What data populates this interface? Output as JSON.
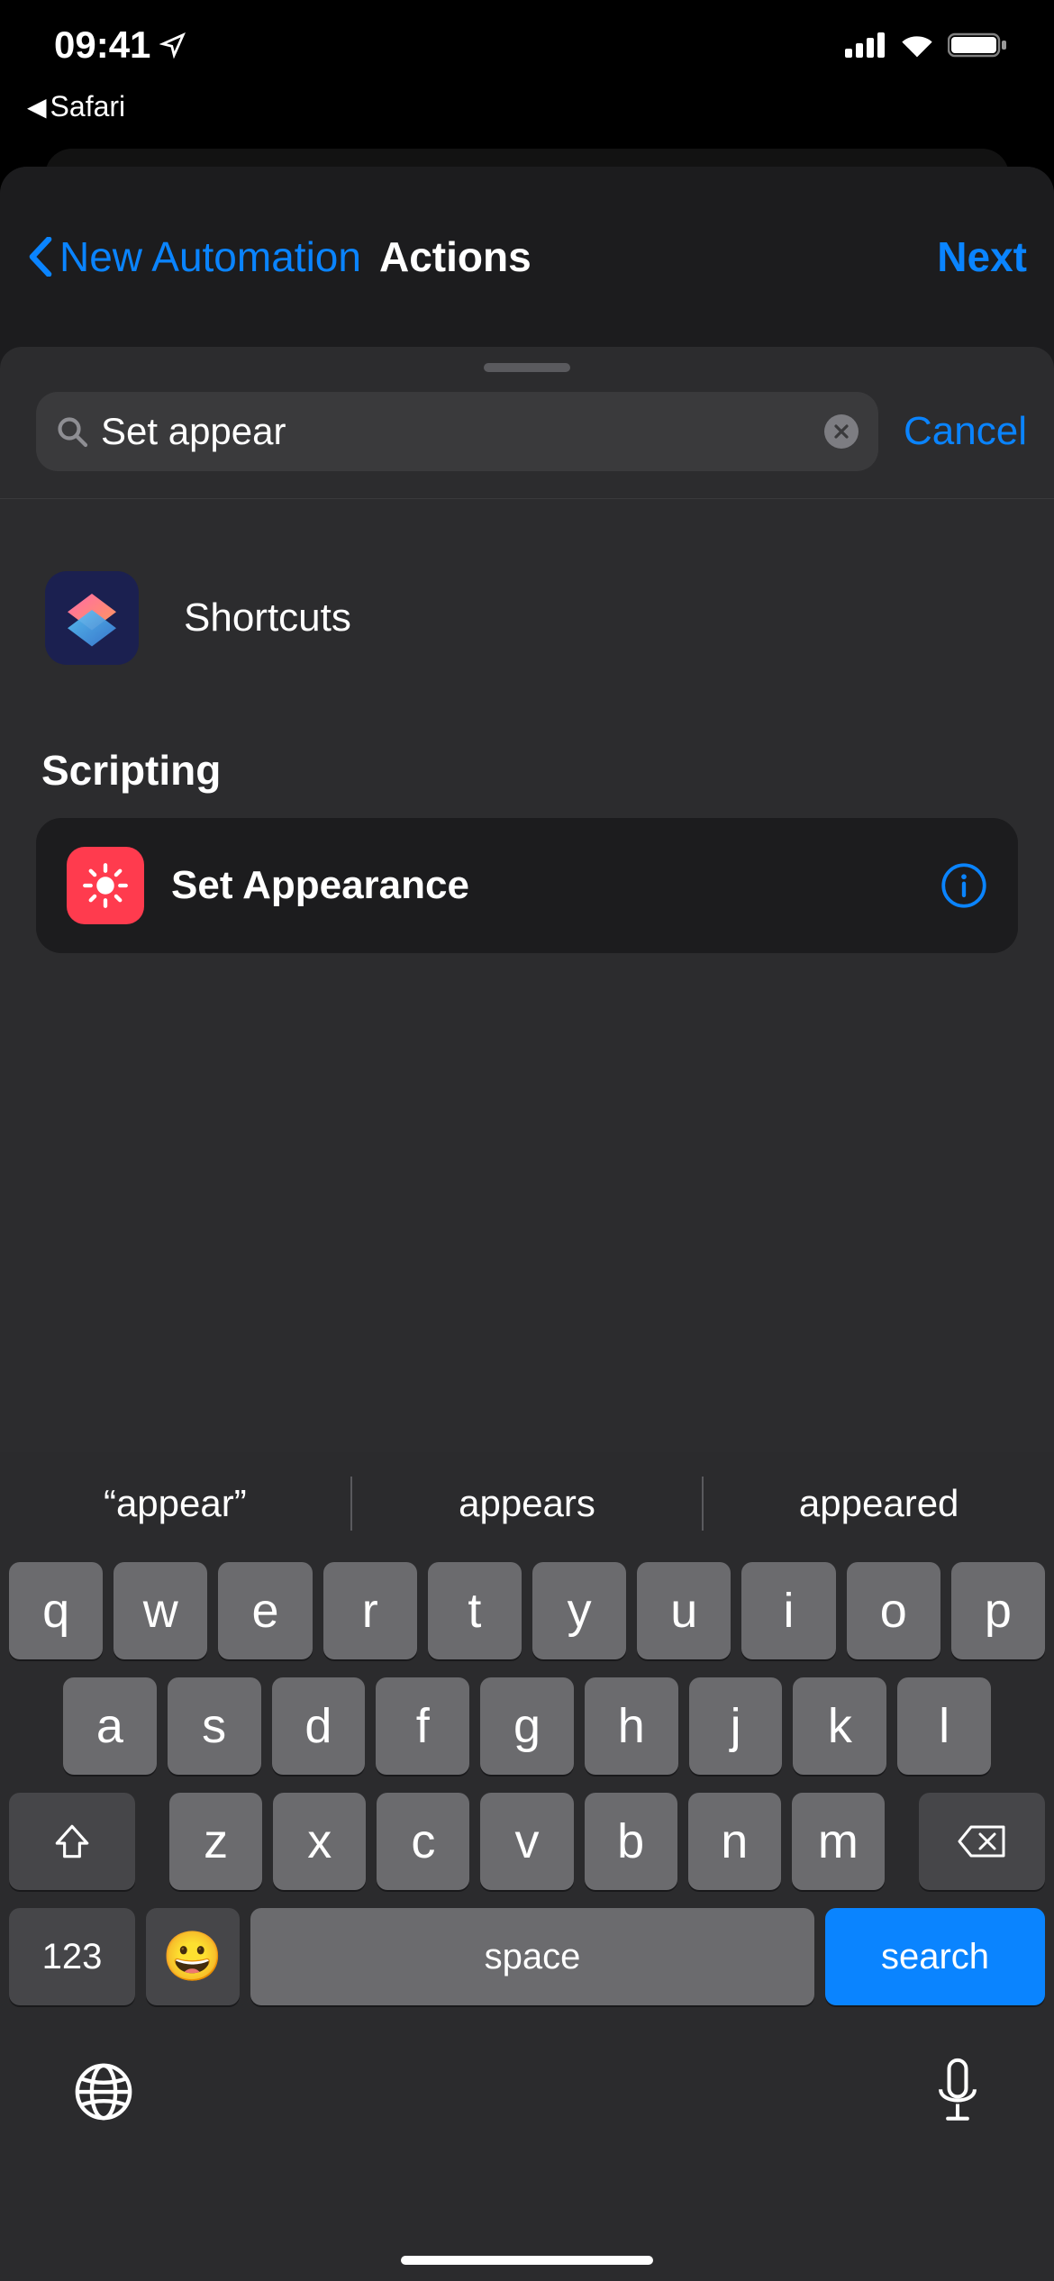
{
  "status": {
    "time": "09:41",
    "breadcrumb": "Safari"
  },
  "nav": {
    "back": "New Automation",
    "title": "Actions",
    "next": "Next"
  },
  "search": {
    "value": "Set appear",
    "cancel": "Cancel"
  },
  "results": {
    "app_label": "Shortcuts",
    "section": "Scripting",
    "action": "Set Appearance"
  },
  "suggestions": [
    "“appear”",
    "appears",
    "appeared"
  ],
  "keyboard": {
    "row1": [
      "q",
      "w",
      "e",
      "r",
      "t",
      "y",
      "u",
      "i",
      "o",
      "p"
    ],
    "row2": [
      "a",
      "s",
      "d",
      "f",
      "g",
      "h",
      "j",
      "k",
      "l"
    ],
    "row3": [
      "z",
      "x",
      "c",
      "v",
      "b",
      "n",
      "m"
    ],
    "num": "123",
    "space": "space",
    "search": "search"
  }
}
